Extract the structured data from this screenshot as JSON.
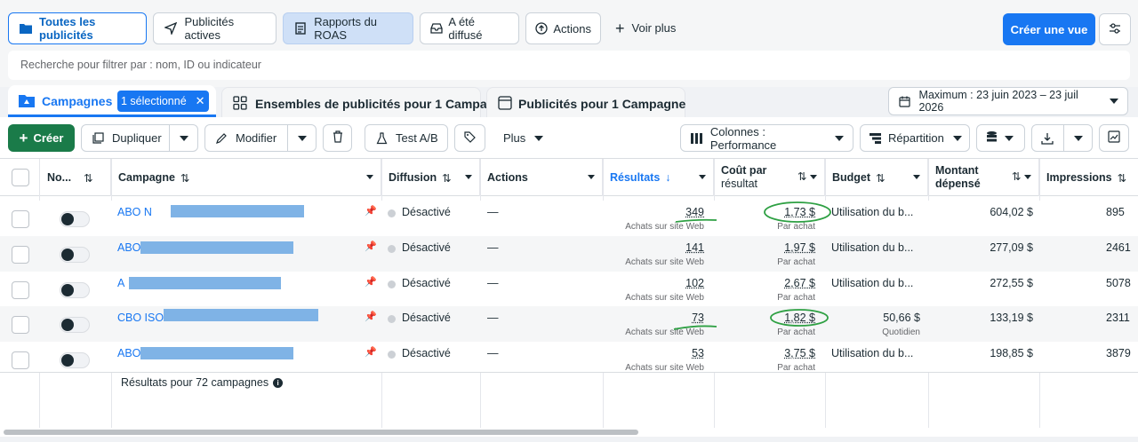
{
  "filters": {
    "tabs": [
      {
        "label": "Toutes les publicités",
        "icon": "folder-icon"
      },
      {
        "label": "Publicités actives",
        "icon": "paper-plane-icon"
      },
      {
        "label": "Rapports du ROAS",
        "icon": "report-icon"
      },
      {
        "label": "A été diffusé",
        "icon": "inbox-icon"
      },
      {
        "label": "Actions",
        "icon": "upload-circle-icon"
      }
    ],
    "see_more": "Voir plus",
    "create_view": "Créer une vue",
    "search_placeholder": "Recherche pour filtrer par : nom, ID ou indicateur"
  },
  "level_tabs": {
    "campaigns": "Campagnes",
    "selected_badge": "1 sélectionné",
    "adsets": "Ensembles de publicités pour 1 Campa",
    "ads": "Publicités pour 1 Campagne",
    "date_range": "Maximum : 23 juin 2023 – 23 juil 2026"
  },
  "toolbar": {
    "create": "Créer",
    "duplicate": "Dupliquer",
    "edit": "Modifier",
    "ab_test": "Test A/B",
    "more": "Plus",
    "columns": "Colonnes : Performance",
    "breakdown": "Répartition"
  },
  "table": {
    "headers": {
      "off_on": "No...",
      "campaign": "Campagne",
      "delivery": "Diffusion",
      "actions": "Actions",
      "results": "Résultats",
      "cost_per_result_1": "Coût par",
      "cost_per_result_2": "résultat",
      "budget": "Budget",
      "amount_spent_1": "Montant",
      "amount_spent_2": "dépensé",
      "impressions": "Impressions"
    },
    "rows": [
      {
        "name": "ABO N",
        "delivery": "Désactivé",
        "actions": "—",
        "results": "349",
        "results_sub": "Achats sur site Web",
        "cpr": "1,73 $",
        "cpr_sub": "Par achat",
        "budget": "Utilisation du b...",
        "budget_sub": "",
        "spent": "604,02 $",
        "impressions": "895"
      },
      {
        "name": "ABO",
        "delivery": "Désactivé",
        "actions": "—",
        "results": "141",
        "results_sub": "Achats sur site Web",
        "cpr": "1,97 $",
        "cpr_sub": "Par achat",
        "budget": "Utilisation du b...",
        "budget_sub": "",
        "spent": "277,09 $",
        "impressions": "2461"
      },
      {
        "name": "A",
        "delivery": "Désactivé",
        "actions": "—",
        "results": "102",
        "results_sub": "Achats sur site Web",
        "cpr": "2,67 $",
        "cpr_sub": "Par achat",
        "budget": "Utilisation du b...",
        "budget_sub": "",
        "spent": "272,55 $",
        "impressions": "5078"
      },
      {
        "name": "CBO ISO",
        "delivery": "Désactivé",
        "actions": "—",
        "results": "73",
        "results_sub": "Achats sur site Web",
        "cpr": "1,82 $",
        "cpr_sub": "Par achat",
        "budget": "50,66 $",
        "budget_sub": "Quotidien",
        "spent": "133,19 $",
        "impressions": "2311"
      },
      {
        "name": "ABO",
        "delivery": "Désactivé",
        "actions": "—",
        "results": "53",
        "results_sub": "Achats sur site Web",
        "cpr": "3,75 $",
        "cpr_sub": "Par achat",
        "budget": "Utilisation du b...",
        "budget_sub": "",
        "spent": "198,85 $",
        "impressions": "3879"
      }
    ],
    "footer": "Résultats pour 72 campagnes"
  },
  "colors": {
    "accent": "#1877f2",
    "annotation": "#2ea043"
  }
}
